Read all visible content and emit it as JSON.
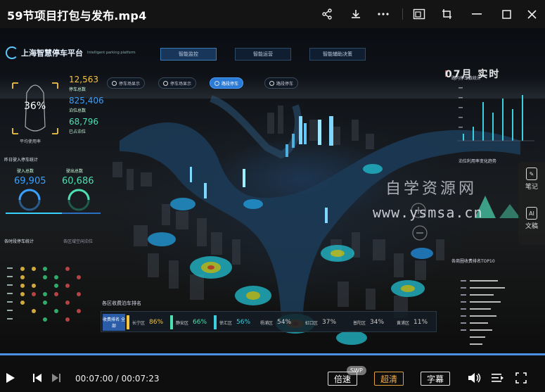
{
  "window": {
    "title": "59节项目打包与发布.mp4"
  },
  "dashboard": {
    "logo": "上海智慧停车平台",
    "logo_sub": "Intelligent parking platform",
    "tabs": [
      "智能监控",
      "智能运营",
      "智能辅助决策"
    ],
    "pills": [
      "停车场显示",
      "停车场显示",
      "路段停车",
      "路段停车"
    ],
    "usage_rate": "36%",
    "usage_label": "平均使用率",
    "stats": [
      {
        "value": "12,563",
        "label": "停车总数",
        "color": "#f5c542"
      },
      {
        "value": "825,406",
        "label": "泊位总数",
        "color": "#3aa0ff"
      },
      {
        "value": "68,796",
        "label": "已占泊位",
        "color": "#4fe0b0"
      }
    ],
    "flow_title": "昨日驶入停车统计",
    "flow": [
      {
        "value": "69,905",
        "label": "驶入总数",
        "color": "#3aa0ff"
      },
      {
        "value": "60,686",
        "label": "驶出总数",
        "color": "#4fe0b0"
      }
    ],
    "grid_title": "各时段停车统计",
    "grid_sub": "各区域空闲泊位",
    "right_title": "路内停车数统计",
    "right_trend_title": "泊位利用率变化趋势",
    "right_date": "07月 实时",
    "ranking_title": "各区收费泊车排名",
    "right_rank_title": "各商圈收费排名TOP10",
    "ranking_head": "收费排名 全部",
    "ranking": [
      {
        "name": "长宁区",
        "pct": "86%",
        "color": "#f5c542"
      },
      {
        "name": "静安区",
        "pct": "66%",
        "color": "#4fe0b0"
      },
      {
        "name": "徐汇区",
        "pct": "56%",
        "color": "#3ad0e0"
      },
      {
        "name": "杨浦区",
        "pct": "54%",
        "color": "#ddd"
      },
      {
        "name": "虹口区",
        "pct": "37%",
        "color": "#ddd"
      },
      {
        "name": "普陀区",
        "pct": "34%",
        "color": "#ddd"
      },
      {
        "name": "黄浦区",
        "pct": "11%",
        "color": "#ddd"
      }
    ],
    "watermark_line1": "自学资源网",
    "watermark_line2": "www.ysmsa.cn"
  },
  "side_tools": [
    {
      "label": "笔记",
      "icon": "note-icon"
    },
    {
      "label": "文稿",
      "icon": "ai-doc-icon"
    }
  ],
  "player": {
    "time": "00:07:00 / 00:07:23",
    "progress": 0.95,
    "speed_label": "倍速",
    "swp_badge": "SWP",
    "quality_label": "超清",
    "subtitle_label": "字幕"
  }
}
